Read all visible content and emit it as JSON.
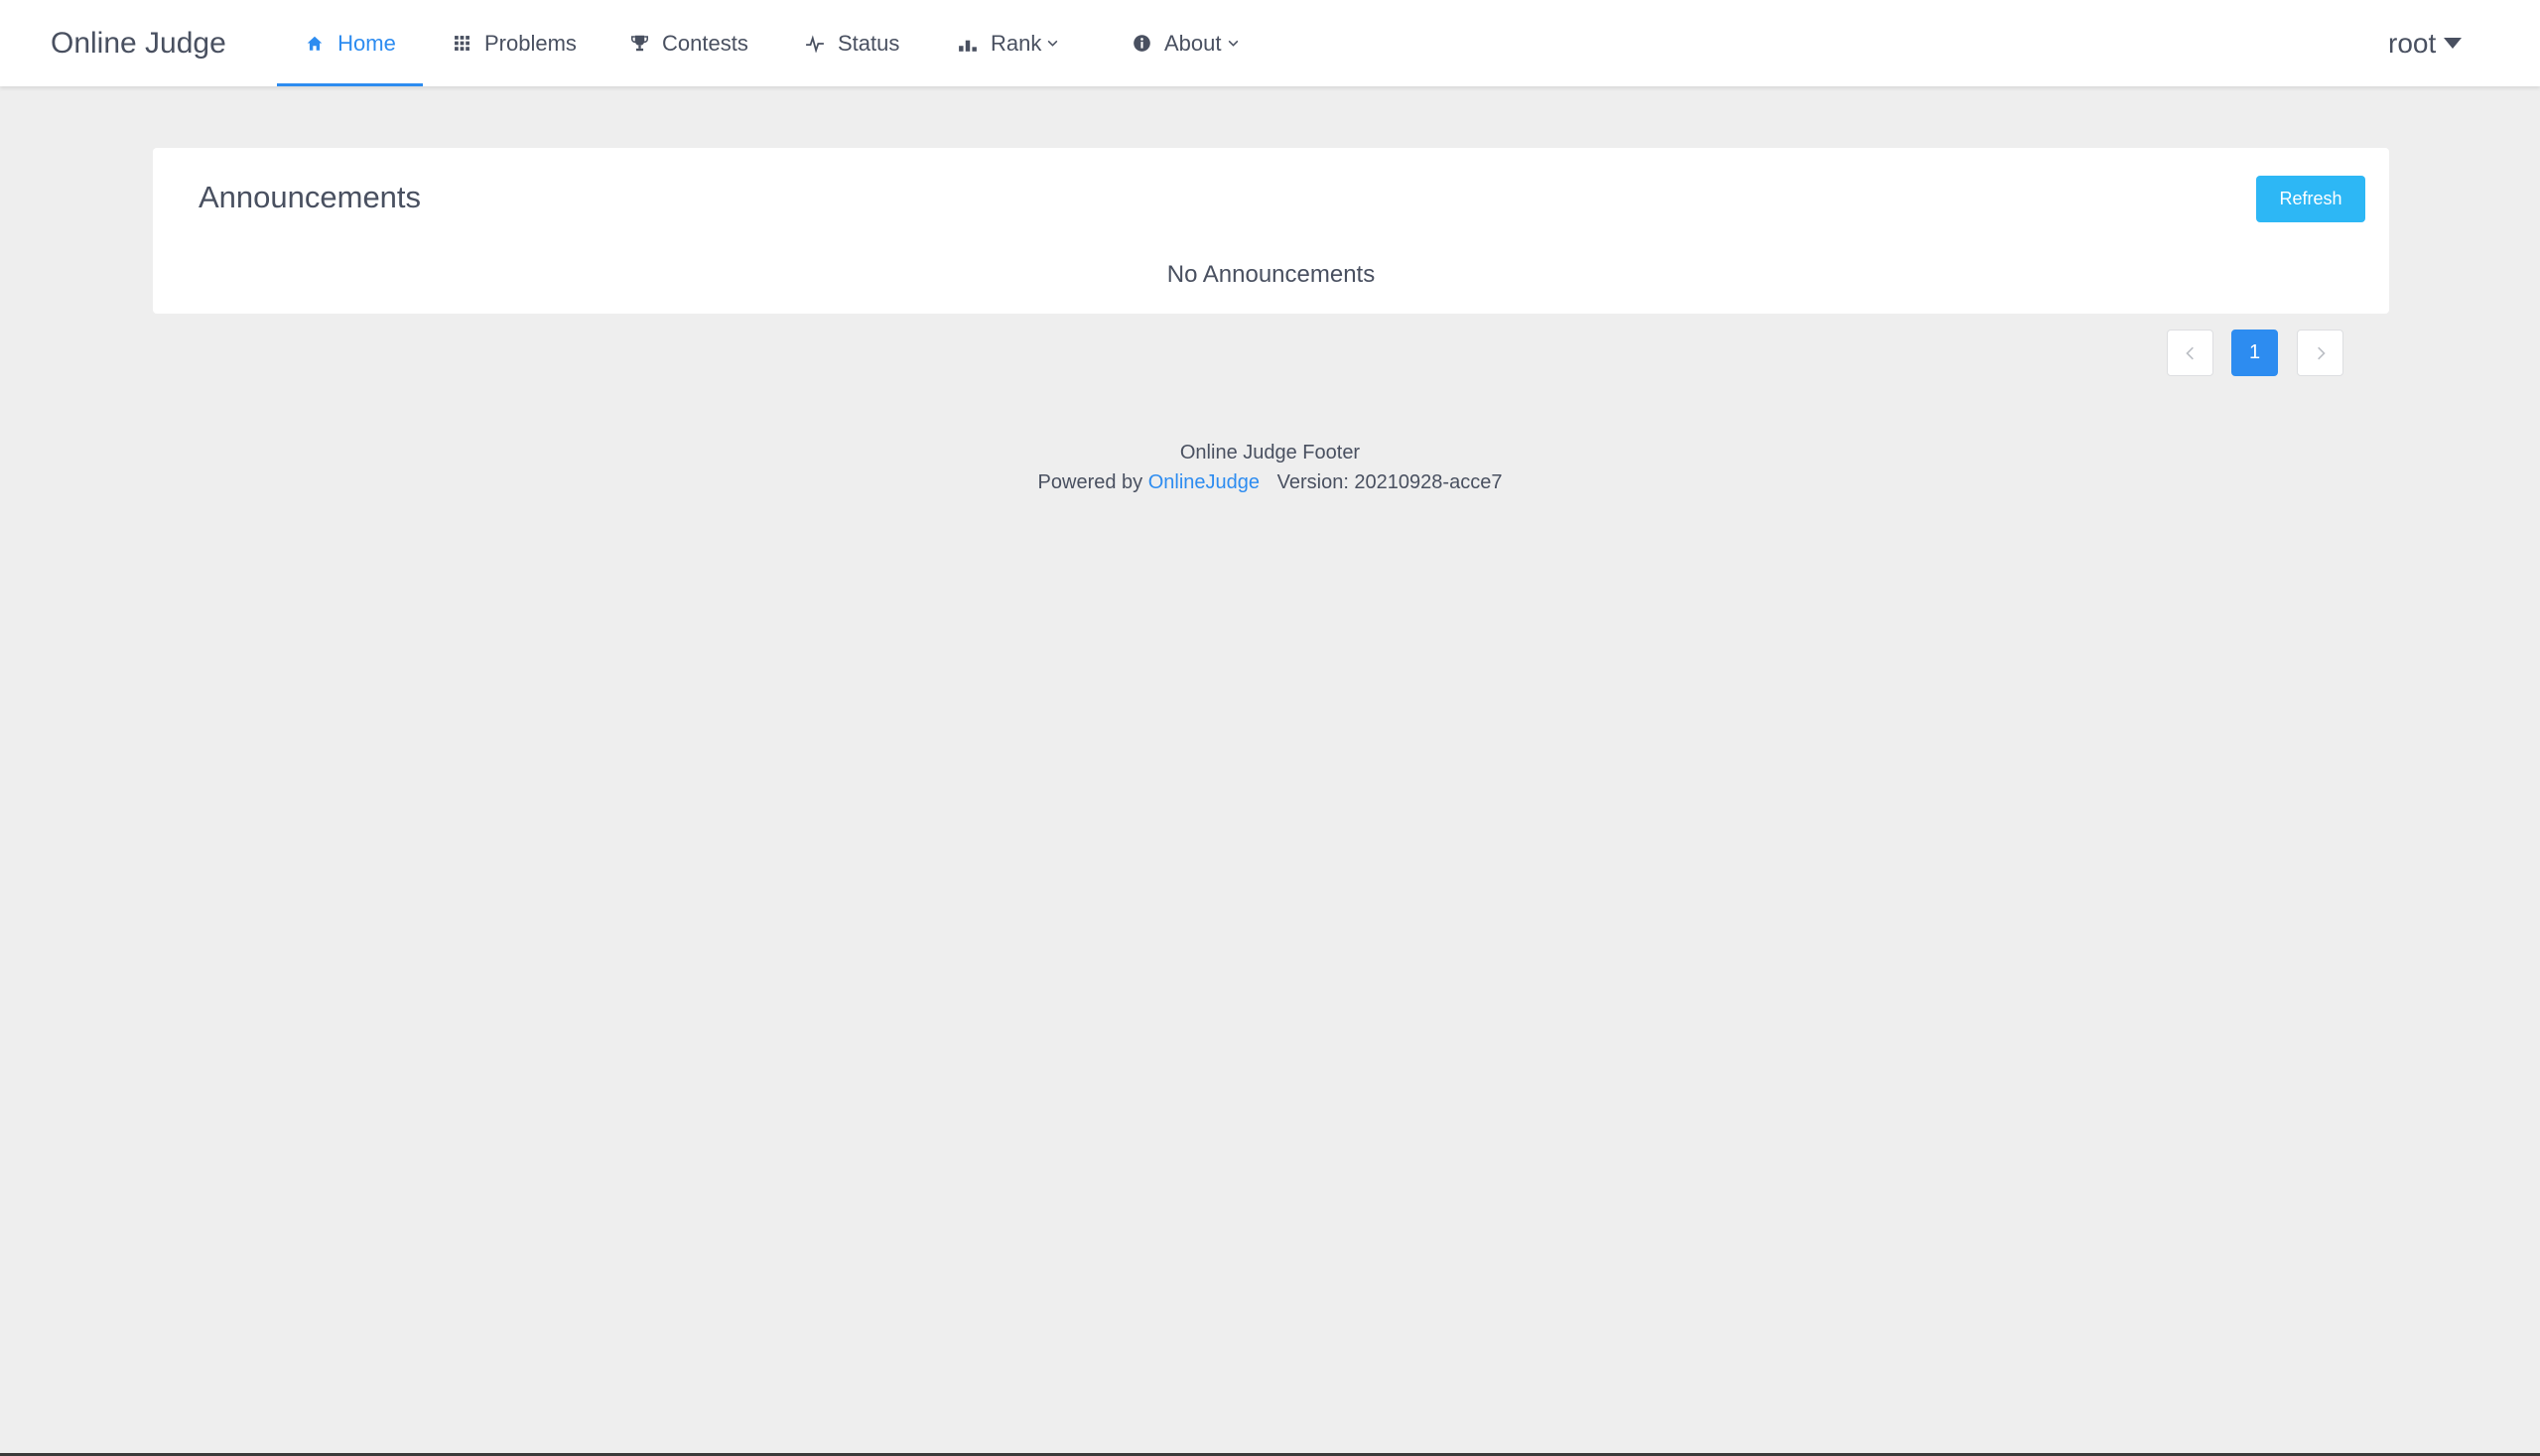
{
  "header": {
    "logo": "Online Judge",
    "nav": [
      {
        "label": "Home",
        "icon": "home-icon",
        "active": true
      },
      {
        "label": "Problems",
        "icon": "grid-icon"
      },
      {
        "label": "Contests",
        "icon": "trophy-icon"
      },
      {
        "label": "Status",
        "icon": "pulse-icon"
      },
      {
        "label": "Rank",
        "icon": "bar-chart-icon",
        "dropdown": true
      },
      {
        "label": "About",
        "icon": "info-icon",
        "dropdown": true
      }
    ],
    "user": "root"
  },
  "announcements": {
    "title": "Announcements",
    "refresh_label": "Refresh",
    "empty_text": "No Announcements"
  },
  "pagination": {
    "current_page": "1"
  },
  "footer": {
    "line1": "Online Judge Footer",
    "powered_prefix": "Powered by",
    "powered_link": "OnlineJudge",
    "version": "Version: 20210928-acce7"
  },
  "colors": {
    "accent": "#2d8cf0",
    "refresh_button": "#2db7f5",
    "background": "#eeeeee",
    "text": "#495060"
  }
}
